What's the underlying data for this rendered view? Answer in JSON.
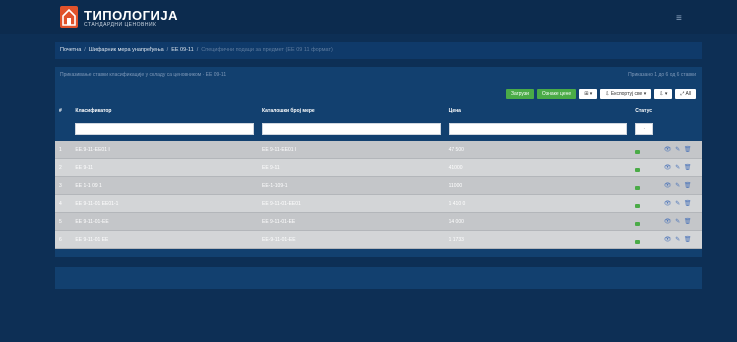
{
  "app": {
    "logo_text": "ТИПОЛОГИЈА",
    "logo_sub": "СТАНДАРДНИ ЦЕНОВНИК"
  },
  "breadcrumb": {
    "items": [
      "Почетна",
      "Шифарник мера унапређења",
      "ЕЕ 09-11"
    ],
    "tail": "Специфични подаци за предмет (ЕЕ 09 11 формат)"
  },
  "panel": {
    "info": "Приказивање ставки класификације у складу са ценовником · ЕЕ 09-11",
    "page_info": "Приказано 1 до 6 од 6 ставки"
  },
  "toolbar": {
    "btn_group": "Загрузи",
    "btn_prices": "Ознаке цене",
    "btn_columns": "⊞ ▾",
    "btn_export": "⇩ Експортуј све ▾",
    "btn_filter": "⇩ ▾",
    "btn_expand": "⤢ All"
  },
  "table": {
    "headers": [
      "#",
      "Класификатор",
      "Каталошки број мере",
      "Цена",
      "Статус",
      ""
    ],
    "status_filter": "·",
    "rows": [
      {
        "idx": "1",
        "cls": "ЕЕ.9-11-ЕЕ01 I",
        "cat": "ЕЕ 9-11-ЕЕ01 I",
        "price": "47 500",
        "actions": "👁 ✎ 🗑"
      },
      {
        "idx": "2",
        "cls": "ЕЕ 9-11",
        "cat": "ЕЕ 9-11",
        "price": "41000",
        "actions": "👁 ✎ 🗑"
      },
      {
        "idx": "3",
        "cls": "ЕЕ 1-1 09 1",
        "cat": "ЕЕ-1-109-1",
        "price": "11000",
        "actions": "👁 ✎ 🗑"
      },
      {
        "idx": "4",
        "cls": "ЕЕ 9-11-01 ЕЕ01-1",
        "cat": "ЕЕ 9-11-01-ЕЕ01",
        "price": "1 410 0",
        "actions": "👁 ✎ 🗑"
      },
      {
        "idx": "5",
        "cls": "ЕЕ 9-11-01-ЕЕ",
        "cat": "ЕЕ 9-11-01-ЕЕ",
        "price": "14 000",
        "actions": "👁 ✎ 🗑"
      },
      {
        "idx": "6",
        "cls": "ЕЕ 9-11-01 ЕЕ",
        "cat": "ЕЕ-9-11-01-ЕЕ",
        "price": "1 1733",
        "actions": "👁 ✎ 🗑"
      }
    ]
  }
}
